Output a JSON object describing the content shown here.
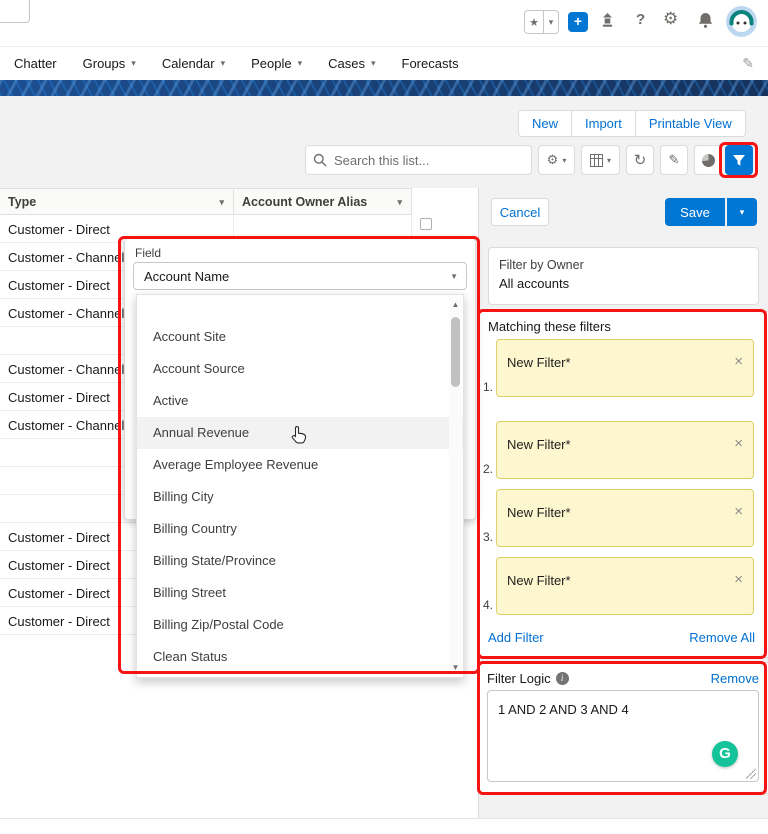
{
  "icons": {
    "chevron_down": "▾",
    "select_caret": "▼",
    "up_arrow": "▲",
    "down_arrow": "▼",
    "star": "★",
    "plus": "+",
    "help": "?",
    "gear": "⚙",
    "refresh": "↻",
    "pencil": "✎",
    "close": "×",
    "grammarly_g": "G",
    "info": "i"
  },
  "nav": {
    "tabs": [
      "Chatter",
      "Groups",
      "Calendar",
      "People",
      "Cases",
      "Forecasts"
    ]
  },
  "list_header": {
    "buttons": {
      "new": "New",
      "import": "Import",
      "printable": "Printable View"
    },
    "search_placeholder": "Search this list..."
  },
  "table": {
    "columns": {
      "type": "Type",
      "owner": "Account Owner Alias"
    },
    "rows": [
      "Customer - Direct",
      "Customer - Channel",
      "Customer - Direct",
      "Customer - Channel",
      "",
      "Customer - Channel",
      "Customer - Direct",
      "Customer - Channel",
      "",
      "",
      "",
      "Customer - Direct",
      "Customer - Direct",
      "Customer - Direct",
      "Customer - Direct"
    ]
  },
  "field_popover": {
    "label": "Field",
    "selected": "Account Name",
    "options": [
      "Account Site",
      "Account Source",
      "Active",
      "Annual Revenue",
      "Average Employee Revenue",
      "Billing City",
      "Billing Country",
      "Billing State/Province",
      "Billing Street",
      "Billing Zip/Postal Code",
      "Clean Status"
    ],
    "highlighted_option": "Annual Revenue"
  },
  "filter_panel": {
    "cancel": "Cancel",
    "save": "Save",
    "owner_label": "Filter by Owner",
    "owner_value": "All accounts",
    "matching_title": "Matching these filters",
    "filters": [
      {
        "num": "1.",
        "label": "New Filter*"
      },
      {
        "num": "2.",
        "label": "New Filter*"
      },
      {
        "num": "3.",
        "label": "New Filter*"
      },
      {
        "num": "4.",
        "label": "New Filter*"
      }
    ],
    "add_filter": "Add Filter",
    "remove_all": "Remove All",
    "logic_title": "Filter Logic",
    "logic_remove": "Remove",
    "logic_value": "1 AND 2 AND 3 AND 4"
  },
  "colors": {
    "brand_blue": "#0176d3",
    "link_blue": "#0070d2",
    "annotation_red": "#f51414",
    "filter_card_yellow": "#fdf7cf",
    "grammarly_green": "#15c39a"
  }
}
